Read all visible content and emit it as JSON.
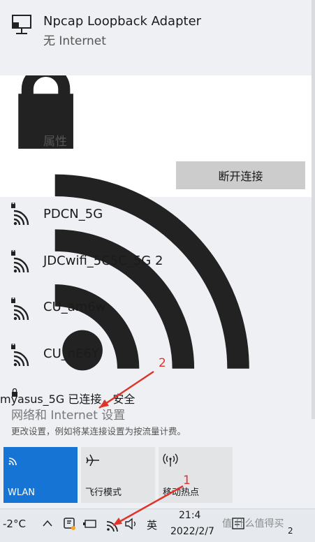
{
  "networks": [
    {
      "name": "Npcap Loopback Adapter",
      "status": "无 Internet",
      "icon": "ethernet-icon"
    },
    {
      "name": "myasus_5G",
      "status": "已连接，安全",
      "properties_label": "属性",
      "disconnect_label": "断开连接",
      "icon": "wifi-secured-icon"
    },
    {
      "name": "PDCN_5G",
      "icon": "wifi-secured-icon"
    },
    {
      "name": "JDCwifi_5C5C_5G 2",
      "icon": "wifi-secured-icon"
    },
    {
      "name": "CU_am6w",
      "icon": "wifi-secured-icon"
    },
    {
      "name": "CU_nE6Y",
      "icon": "wifi-secured-icon"
    }
  ],
  "settings": {
    "link": "网络和 Internet 设置",
    "description": "更改设置，例如将某连接设置为按流量计费。"
  },
  "quick_actions": [
    {
      "label": "WLAN",
      "active": true,
      "icon": "wifi-icon"
    },
    {
      "label": "飞行模式",
      "active": false,
      "icon": "airplane-icon"
    },
    {
      "label": "移动热点",
      "active": false,
      "icon": "hotspot-icon"
    }
  ],
  "taskbar": {
    "temperature": "-2°C",
    "input_method": "英",
    "time": "21:4",
    "date": "2022/2/7",
    "notification_count": "2",
    "watermark": "值 什么值得买"
  },
  "annotations": {
    "one": "1",
    "two": "2"
  },
  "colors": {
    "accent": "#1574d4",
    "annotation": "#e0342b",
    "panel": "#eef0f3"
  }
}
